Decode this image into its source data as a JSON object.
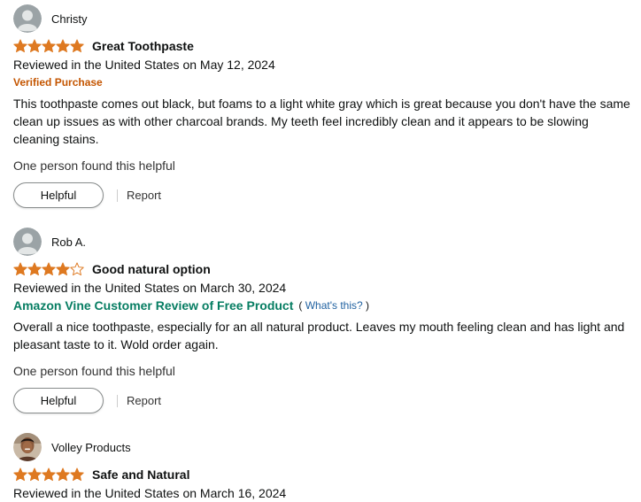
{
  "colors": {
    "star_fill": "#de7921",
    "verified": "#c45500",
    "vine": "#067d62",
    "link": "#2162a1"
  },
  "reviews": [
    {
      "author": "Christy",
      "avatar_icon": "default-avatar-icon",
      "rating": 5,
      "title": "Great Toothpaste",
      "date": "Reviewed in the United States on May 12, 2024",
      "badge": "Verified Purchase",
      "body": "This toothpaste comes out black, but foams to a light white gray which is great because you don't have the same clean up issues as with other charcoal brands. My teeth feel incredibly clean and it appears to be slowing cleaning stains.",
      "helpful_count": "One person found this helpful",
      "helpful_label": "Helpful",
      "report_label": "Report"
    },
    {
      "author": "Rob A.",
      "avatar_icon": "default-avatar-icon",
      "rating": 4,
      "title": "Good natural option",
      "date": "Reviewed in the United States on March 30, 2024",
      "vine_label": "Amazon Vine Customer Review of Free Product",
      "vine_open": "(",
      "vine_whats": "What's this?",
      "vine_close": ")",
      "body": "Overall a nice toothpaste, especially for an all natural product. Leaves my mouth feeling clean and has light and pleasant taste to it. Wold order again.",
      "helpful_count": "One person found this helpful",
      "helpful_label": "Helpful",
      "report_label": "Report"
    },
    {
      "author": "Volley Products",
      "avatar_icon": "photo-avatar-icon",
      "rating": 5,
      "title": "Safe and Natural",
      "date": "Reviewed in the United States on March 16, 2024"
    }
  ]
}
